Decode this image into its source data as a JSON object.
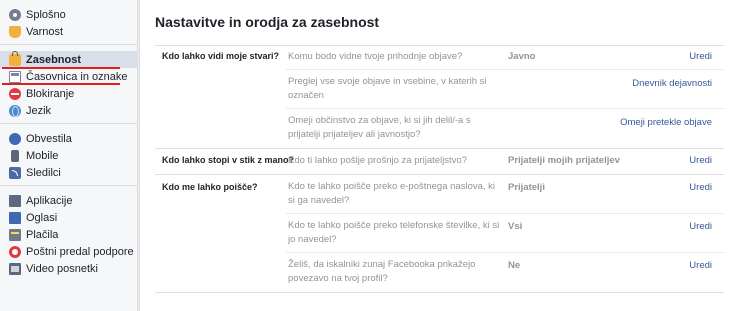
{
  "sidebar": {
    "groups": [
      [
        {
          "label": "Splošno",
          "icon": "gear-icon"
        },
        {
          "label": "Varnost",
          "icon": "shield-icon"
        }
      ],
      [
        {
          "label": "Zasebnost",
          "icon": "lock-icon",
          "active": true
        },
        {
          "label": "Časovnica in oznake",
          "icon": "timeline-icon"
        },
        {
          "label": "Blokiranje",
          "icon": "block-icon"
        },
        {
          "label": "Jezik",
          "icon": "globe-icon"
        }
      ],
      [
        {
          "label": "Obvestila",
          "icon": "globe-notification-icon"
        },
        {
          "label": "Mobile",
          "icon": "mobile-icon"
        },
        {
          "label": "Sledilci",
          "icon": "rss-icon"
        }
      ],
      [
        {
          "label": "Aplikacije",
          "icon": "apps-icon"
        },
        {
          "label": "Oglasi",
          "icon": "ads-icon"
        },
        {
          "label": "Plačila",
          "icon": "payment-icon"
        },
        {
          "label": "Poštni predal podpore",
          "icon": "support-icon"
        },
        {
          "label": "Video posnetki",
          "icon": "video-icon"
        }
      ]
    ]
  },
  "main": {
    "title": "Nastavitve in orodja za zasebnost",
    "sections": [
      {
        "label": "Kdo lahko vidi moje stvari?",
        "rows": [
          {
            "question": "Komu bodo vidne tvoje prihodnje objave?",
            "value": "Javno",
            "action": "Uredi"
          },
          {
            "question": "Preglej vse svoje objave in vsebine, v katerih si označen",
            "value": "",
            "action": "Dnevnik dejavnosti"
          },
          {
            "question": "Omeji občinstvo za objave, ki si jih delil/-a s prijatelji prijateljev ali javnostjo?",
            "value": "",
            "action": "Omeji pretekle objave"
          }
        ]
      },
      {
        "label": "Kdo lahko stopi v stik z mano?",
        "rows": [
          {
            "question": "Kdo ti lahko pošlje prošnjo za prijateljstvo?",
            "value": "Prijatelji mojih prijateljev",
            "action": "Uredi"
          }
        ]
      },
      {
        "label": "Kdo me lahko poišče?",
        "rows": [
          {
            "question": "Kdo te lahko poišče preko e-poštnega naslova, ki si ga navedel?",
            "value": "Prijatelji",
            "action": "Uredi"
          },
          {
            "question": "Kdo te lahko poišče preko telefonske številke, ki si jo navedel?",
            "value": "Vsi",
            "action": "Uredi"
          },
          {
            "question": "Želiš, da iskalniki zunaj Facebooka prikažejo povezavo na tvoj profil?",
            "value": "Ne",
            "action": "Uredi"
          }
        ]
      }
    ]
  },
  "colors": {
    "link": "#365899",
    "active_bg": "#d8dfea",
    "annotation_underline": "#e02020"
  }
}
